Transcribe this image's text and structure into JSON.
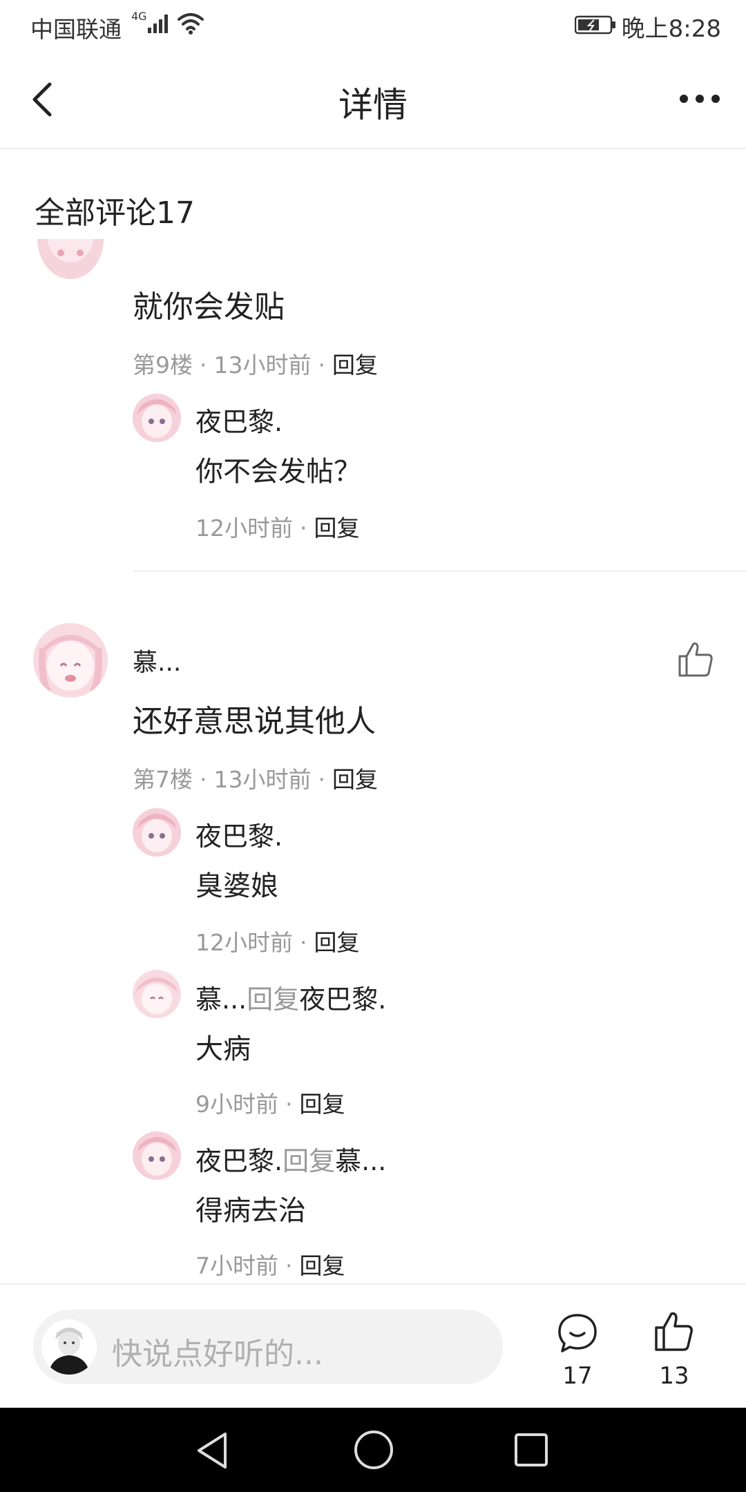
{
  "status_bar": {
    "carrier": "中国联通",
    "network": "4G",
    "time": "晚上8:28"
  },
  "header": {
    "title": "详情"
  },
  "comments_section": {
    "title": "全部评论17"
  },
  "comments": [
    {
      "text": "就你会发贴",
      "floor": "第9楼",
      "time": "13小时前",
      "reply_label": "回复",
      "replies": [
        {
          "user": "夜巴黎.",
          "text": "你不会发帖？",
          "time": "12小时前",
          "reply_label": "回复"
        }
      ]
    },
    {
      "user": "慕...",
      "text": "还好意思说其他人",
      "floor": "第7楼",
      "time": "13小时前",
      "reply_label": "回复",
      "replies": [
        {
          "user": "夜巴黎.",
          "text": "臭婆娘",
          "time": "12小时前",
          "reply_label": "回复"
        },
        {
          "user": "慕...",
          "reply_word": "回复",
          "target": "夜巴黎.",
          "text": "大病",
          "time": "9小时前",
          "reply_label": "回复"
        },
        {
          "user": "夜巴黎.",
          "reply_word": "回复",
          "target": "慕...",
          "text": "得病去治",
          "time": "7小时前",
          "reply_label": "回复"
        }
      ]
    }
  ],
  "bottom_bar": {
    "placeholder": "快说点好听的...",
    "comment_count": "17",
    "like_count": "13"
  },
  "colors": {
    "text": "#222222",
    "muted": "#999999",
    "input_bg": "#f2f2f2",
    "avatar_pink": "#f3c6d0"
  }
}
